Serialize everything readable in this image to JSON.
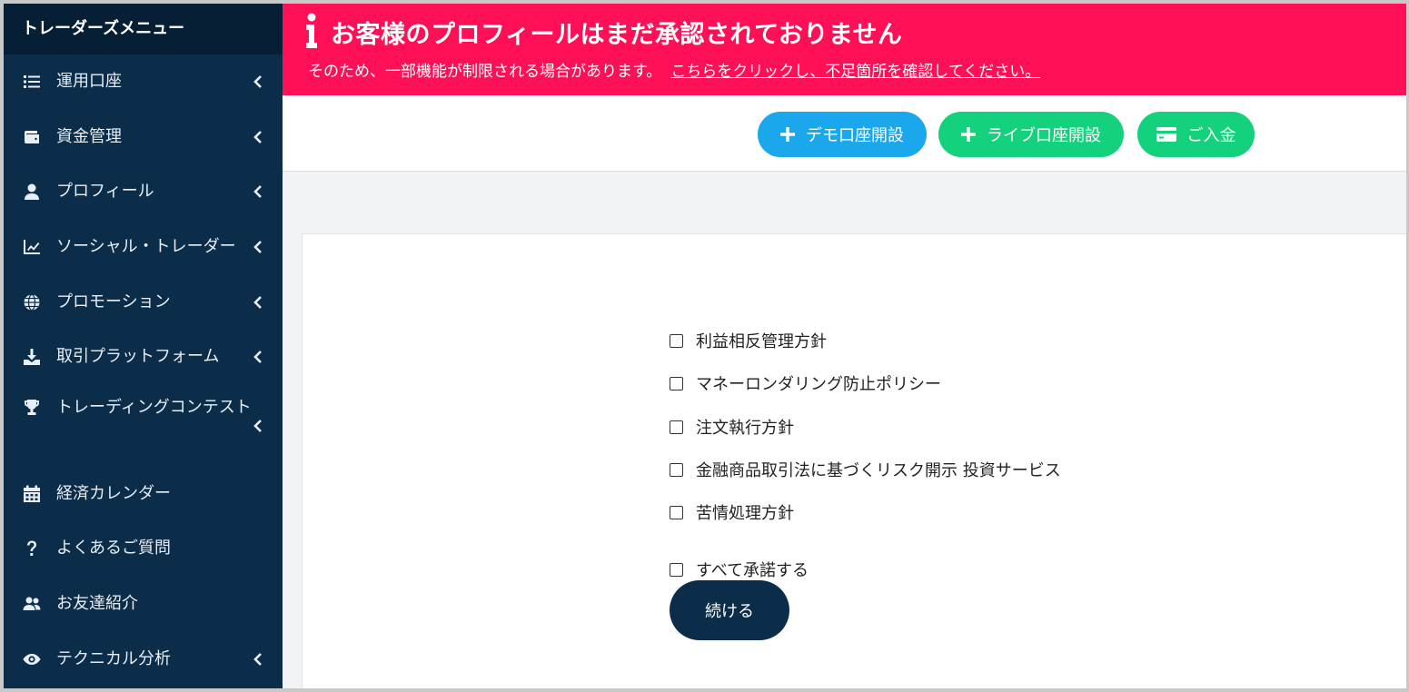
{
  "sidebar": {
    "title": "トレーダーズメニュー",
    "items": [
      {
        "label": "運用口座",
        "icon": "list-icon"
      },
      {
        "label": "資金管理",
        "icon": "wallet-icon"
      },
      {
        "label": "プロフィール",
        "icon": "user-icon"
      },
      {
        "label": "ソーシャル・トレーダー",
        "icon": "chart-line-icon"
      },
      {
        "label": "プロモーション",
        "icon": "globe-icon"
      },
      {
        "label": "取引プラットフォーム",
        "icon": "download-icon"
      },
      {
        "label": "トレーディングコンテスト",
        "icon": "trophy-icon"
      },
      {
        "label": "経済カレンダー",
        "icon": "calendar-icon"
      },
      {
        "label": "よくあるご質問",
        "icon": "question-icon"
      },
      {
        "label": "お友達紹介",
        "icon": "users-icon"
      },
      {
        "label": "テクニカル分析",
        "icon": "eye-icon"
      }
    ]
  },
  "alert": {
    "title": "お客様のプロフィールはまだ承認されておりません",
    "description": "そのため、一部機能が制限される場合があります。",
    "link": "こちらをクリックし、不足箇所を確認してください。",
    "color": "#ff0f55"
  },
  "toolbar": {
    "demo_label": "デモ口座開設",
    "live_label": "ライブ口座開設",
    "deposit_label": "ご入金",
    "demo_color": "#1aa7ec",
    "live_color": "#13d17c"
  },
  "consent": {
    "items": [
      "利益相反管理方針",
      "マネーロンダリング防止ポリシー",
      "注文執行方針",
      "金融商品取引法に基づくリスク開示 投資サービス",
      "苦情処理方針"
    ],
    "accept_all": "すべて承諾する",
    "continue_label": "続ける"
  }
}
